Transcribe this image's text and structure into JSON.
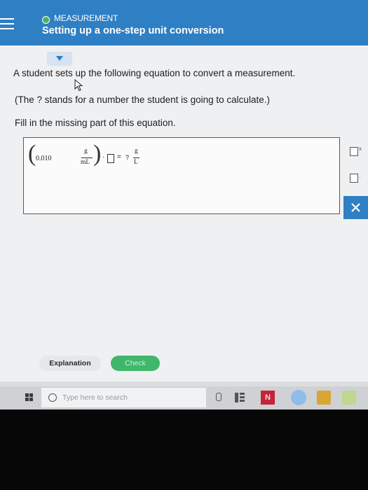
{
  "header": {
    "topic_label": "MEASUREMENT",
    "title": "Setting up a one-step unit conversion",
    "accent_color": "#2f7fc4",
    "status_dot_color": "#49b35a"
  },
  "question": {
    "line1": "A student sets up the following equation to convert a measurement.",
    "line2": "(The ? stands for a number the student is going to calculate.)",
    "line3": "Fill in the missing part of this equation."
  },
  "equation": {
    "value": "0.010",
    "unit_numerator": "g",
    "unit_denominator": "mL",
    "dot": "·",
    "equals": "=",
    "unknown": "?",
    "result_numerator": "g",
    "result_denominator": "L"
  },
  "tools": {
    "superscript_label": "x",
    "dot_label": "·",
    "clear_icon": "close-icon"
  },
  "buttons": {
    "explanation": "Explanation",
    "check": "Check",
    "check_color": "#3fb76a"
  },
  "taskbar": {
    "search_placeholder": "Type here to search",
    "app_n_label": "N"
  }
}
